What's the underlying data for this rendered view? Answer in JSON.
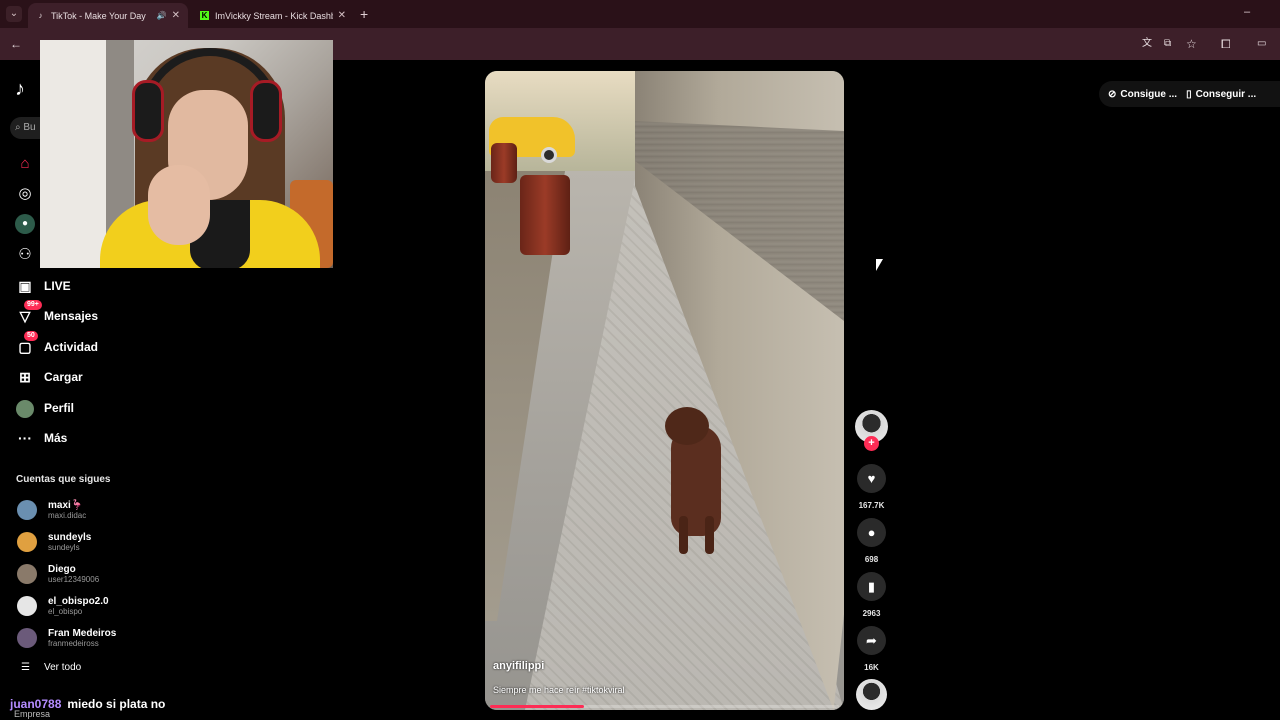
{
  "browser": {
    "tabs": [
      {
        "title": "TikTok - Make Your Day",
        "active": true
      },
      {
        "title": "ImVickky Stream - Kick Dashbo",
        "active": false
      }
    ],
    "new_tab": "+",
    "window_controls": [
      "–",
      "☐",
      "✕"
    ]
  },
  "tiktok": {
    "search_placeholder": "Bu",
    "nav": [
      {
        "label": "LIVE",
        "icon": "live-icon"
      },
      {
        "label": "Mensajes",
        "icon": "messages-icon",
        "badge": "99+"
      },
      {
        "label": "Actividad",
        "icon": "activity-icon",
        "badge": "50"
      },
      {
        "label": "Cargar",
        "icon": "upload-icon"
      },
      {
        "label": "Perfil",
        "icon": "profile-icon"
      },
      {
        "label": "Más",
        "icon": "more-icon"
      }
    ],
    "following_title": "Cuentas que sigues",
    "following": [
      {
        "name": "maxi🦩",
        "handle": "maxi.didac",
        "color": "#6a8fb0"
      },
      {
        "name": "sundeyls",
        "handle": "sundeyls",
        "color": "#e0a040"
      },
      {
        "name": "Diego",
        "handle": "user12349006",
        "color": "#8a7a6a"
      },
      {
        "name": "el_obispo2.0",
        "handle": "el_obispo",
        "color": "#e6e6e6"
      },
      {
        "name": "Fran Medeiros",
        "handle": "franmedeiross",
        "color": "#6b5a7a"
      }
    ],
    "see_all": "Ver todo",
    "top_right": {
      "coins": "Consigue ...",
      "app": "Conseguir ..."
    },
    "video": {
      "author": "anyifilippi",
      "caption": "Siempre me hace reír #tiktokviral",
      "progress": 0.27
    },
    "actions": {
      "likes": "167.7K",
      "comments": "698",
      "saves": "2963",
      "shares": "16K"
    }
  },
  "chat": {
    "user": "juan0788",
    "message": "miedo si plata no",
    "sub": "Empresa"
  },
  "colors": {
    "accent": "#fe2c55",
    "chat_user": "#b48cff"
  }
}
